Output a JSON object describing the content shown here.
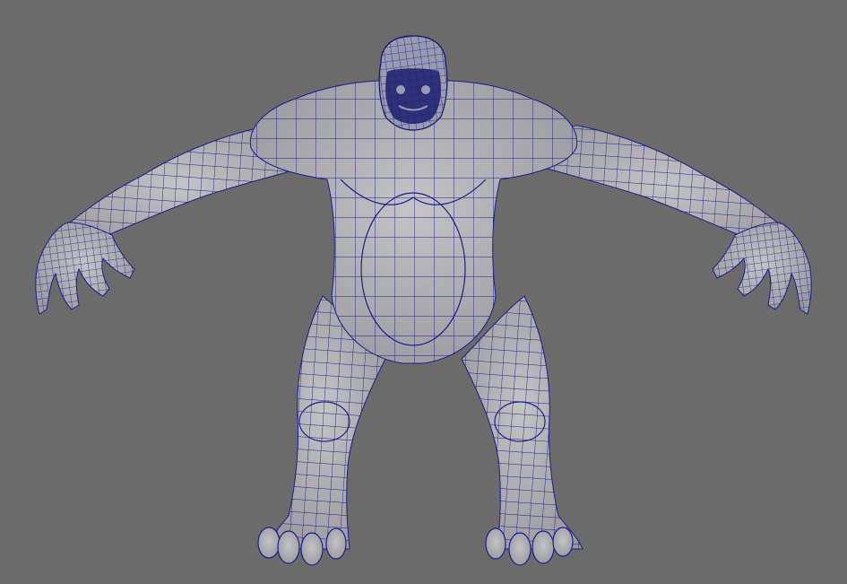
{
  "viewport": {
    "background": "#6b6b6b",
    "mesh_fill": "#b3b3b6",
    "mesh_shade": "#8e8e95",
    "wire_color": "#1a1f8c",
    "wire_dense": "#0f1466",
    "display_mode": "wireframe-on-shaded",
    "model": "gorilla-creature-t-pose"
  }
}
